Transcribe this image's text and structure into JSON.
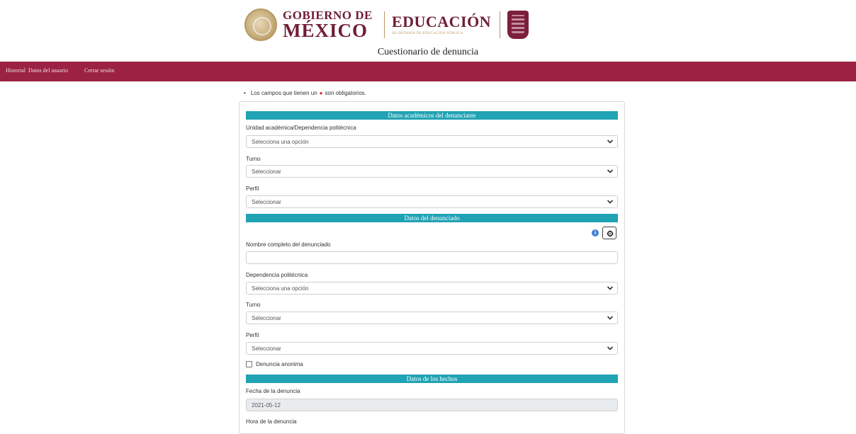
{
  "header": {
    "gov_line1": "GOBIERNO DE",
    "gov_line2": "MÉXICO",
    "edu_title": "EDUCACIÓN",
    "edu_subtitle": "SECRETARÍA DE EDUCACIÓN PÚBLICA",
    "page_subtitle": "Cuestionario de denuncia"
  },
  "nav": {
    "items": [
      {
        "label": "Historial"
      },
      {
        "label": "Datos del usuario"
      },
      {
        "label": "Cerrar sesión"
      }
    ]
  },
  "notice": {
    "prefix": "Los campos que tienen un",
    "suffix": "son obligatorios."
  },
  "sections": {
    "academic": {
      "title": "Datos académicos del denunciante",
      "unidad_label": "Unidad académica/Dependencia politécnica",
      "unidad_value": "Selecciona una opción",
      "turno_label": "Turno",
      "turno_value": "Seleccionar",
      "perfil_label": "Perfil",
      "perfil_value": "Seleccionar"
    },
    "accused": {
      "title": "Datos del denunciado",
      "nombre_label": "Nombre completo del denunciado",
      "nombre_value": "",
      "dependencia_label": "Dependencia politécnica",
      "dependencia_value": "Selecciona una opción",
      "turno_label": "Turno",
      "turno_value": "Seleccionar",
      "perfil_label": "Perfil",
      "perfil_value": "Seleccionar",
      "anonymous_label": "Denuncia anonima",
      "anonymous_checked": false
    },
    "facts": {
      "title": "Datos de los hechos",
      "fecha_label": "Fecha de la denuncia",
      "fecha_value": "2021-05-12",
      "hora_label": "Hora de la denuncia"
    }
  },
  "colors": {
    "navbar": "#9b2242",
    "section_bar": "#20a3b4",
    "required": "#d9262c",
    "info": "#3f7fd6"
  },
  "icons": {
    "info": "info-icon",
    "gear": "gear-icon",
    "chevron": "chevron-down-icon"
  }
}
